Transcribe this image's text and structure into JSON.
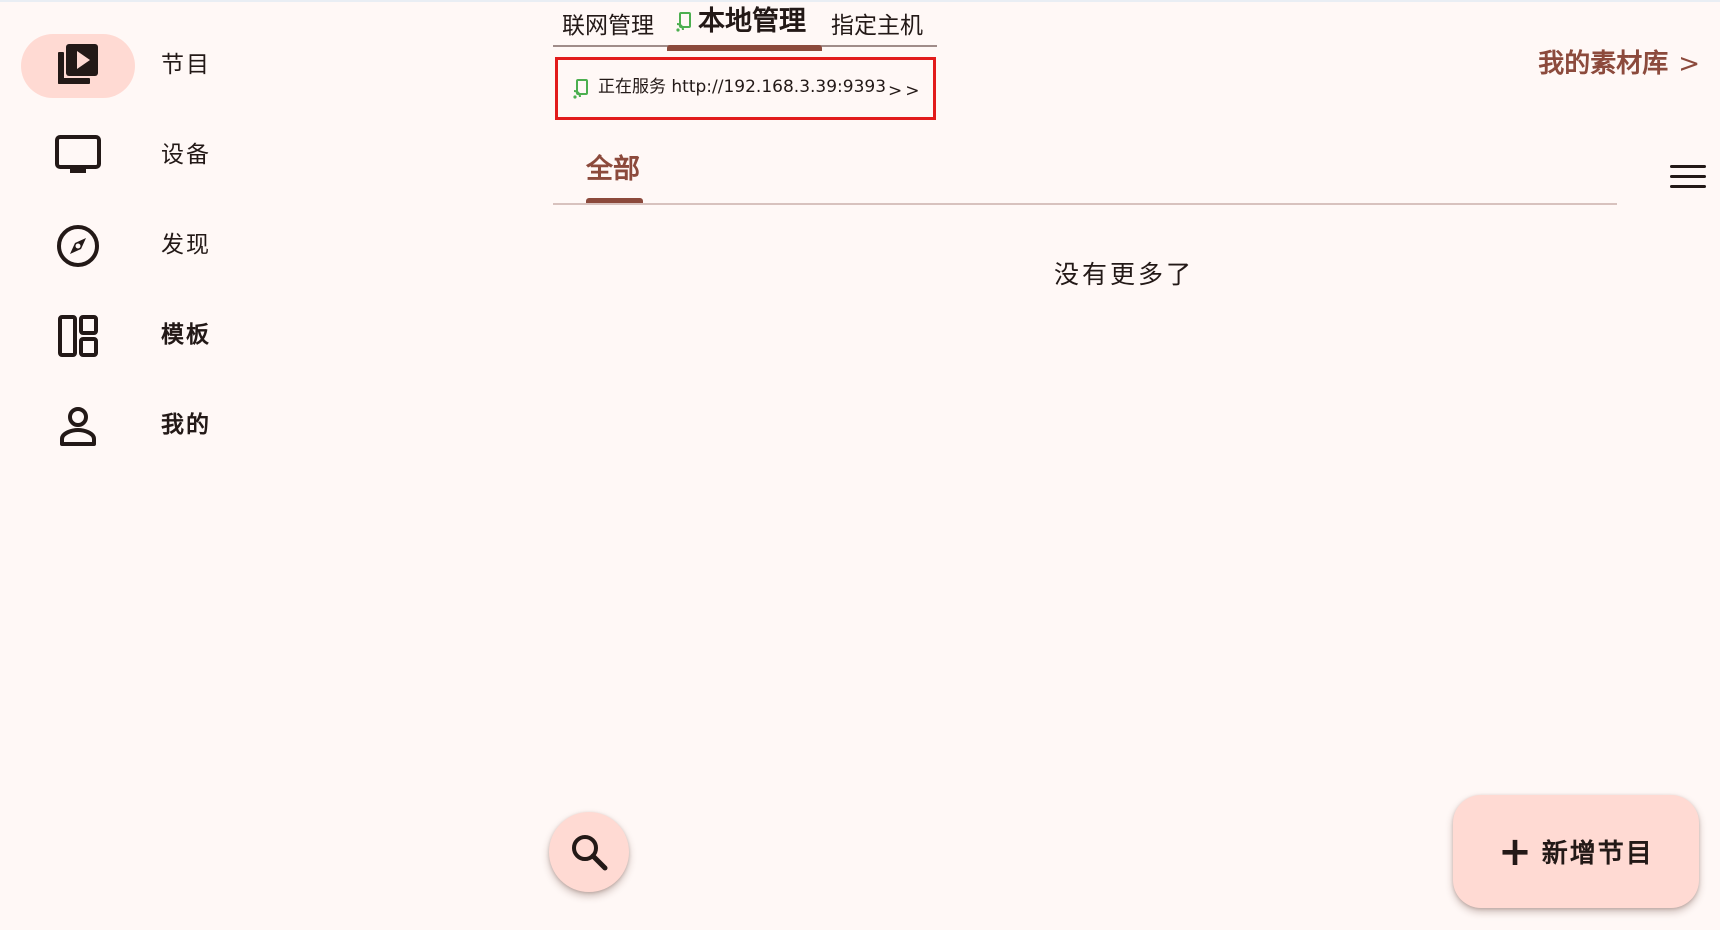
{
  "nav": {
    "items": [
      {
        "label": "节目",
        "icon": "video-library-icon",
        "active": true
      },
      {
        "label": "设备",
        "icon": "monitor-icon",
        "active": false
      },
      {
        "label": "发现",
        "icon": "compass-icon",
        "active": false
      },
      {
        "label": "模板",
        "icon": "dashboard-layout-icon",
        "active": false
      },
      {
        "label": "我的",
        "icon": "person-icon",
        "active": false
      }
    ]
  },
  "top_tabs": {
    "items": [
      {
        "label": "联网管理",
        "active": false
      },
      {
        "label": "本地管理",
        "active": true,
        "icon": "cast-icon"
      },
      {
        "label": "指定主机",
        "active": false
      }
    ]
  },
  "service": {
    "status": "正在服务",
    "url": "http://192.168.3.39:9393",
    "more": ">>",
    "icon": "cast-icon"
  },
  "library_link": {
    "label": "我的素材库",
    "chevron": ">"
  },
  "categories": {
    "items": [
      {
        "label": "全部",
        "active": true
      }
    ]
  },
  "empty_state": {
    "text": "没有更多了"
  },
  "fab": {
    "search_icon": "search-icon",
    "add_label": "新增节目",
    "add_symbol": "+"
  },
  "colors": {
    "background": "#fff8f6",
    "accent": "#8c4a3c",
    "container": "#ffdad3",
    "text": "#231917",
    "cast_green": "#4caf50",
    "highlight_red": "#e21b1b"
  }
}
